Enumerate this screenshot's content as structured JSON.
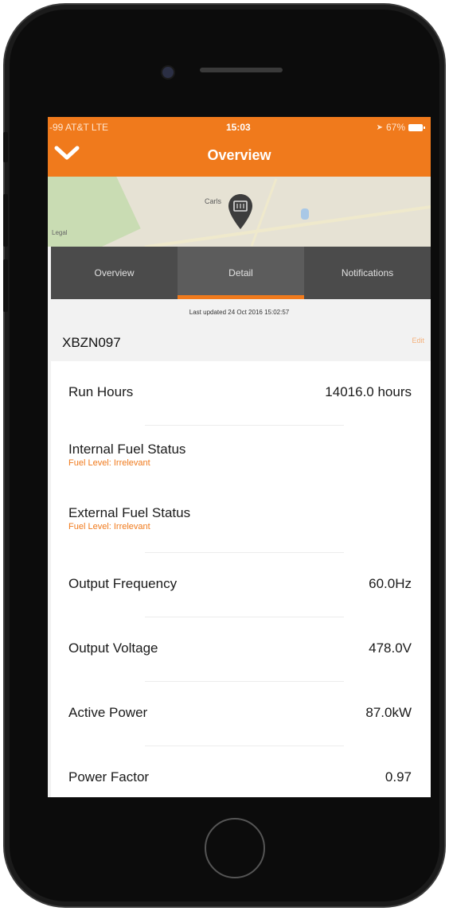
{
  "status_bar": {
    "carrier": "-99 AT&T  LTE",
    "time": "15:03",
    "battery": "67%"
  },
  "header": {
    "title": "Overview"
  },
  "map": {
    "town": "Carls",
    "legal": "Legal"
  },
  "tabs": [
    {
      "label": "Overview",
      "active": false
    },
    {
      "label": "Detail",
      "active": true
    },
    {
      "label": "Notifications",
      "active": false
    }
  ],
  "last_updated": "Last updated 24 Oct 2016 15:02:57",
  "asset": {
    "name": "XBZN097",
    "edit": "Edit"
  },
  "rows": [
    {
      "label": "Run Hours",
      "value": "14016.0 hours"
    },
    {
      "label": "Internal Fuel Status",
      "sub": "Fuel Level: Irrelevant"
    },
    {
      "label": "External Fuel Status",
      "sub": "Fuel Level: Irrelevant"
    },
    {
      "label": "Output Frequency",
      "value": "60.0Hz"
    },
    {
      "label": "Output Voltage",
      "value": "478.0V"
    },
    {
      "label": "Active Power",
      "value": "87.0kW"
    },
    {
      "label": "Power Factor",
      "value": "0.97"
    }
  ],
  "colors": {
    "accent": "#f07a1c",
    "tab_bar": "#4b4b4b"
  }
}
